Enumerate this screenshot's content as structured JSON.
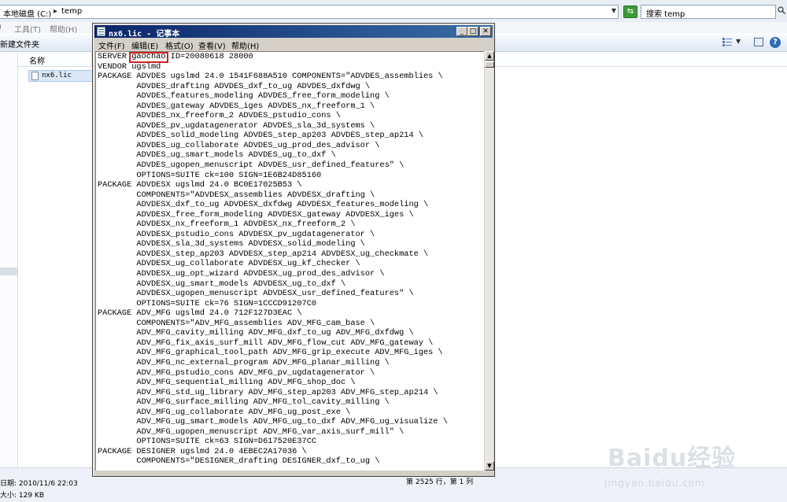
{
  "explorer": {
    "address_path": [
      "本地磁盘 (C:)",
      "temp"
    ],
    "search_placeholder": "搜索 temp",
    "menu": [
      "工具(T)",
      "帮助(H)"
    ],
    "toolbar": {
      "new_folder": "新建文件夹"
    },
    "column_header": "名称",
    "file": {
      "name": "nx6.lic"
    },
    "details": {
      "modified": "日期: 2010/11/6 22:03",
      "size": "大小: 129 KB"
    }
  },
  "notepad": {
    "title": "nx6.lic - 记事本",
    "menu": [
      "文件(F)",
      "编辑(E)",
      "格式(O)",
      "查看(V)",
      "帮助(H)"
    ],
    "highlighted_text": "gaochao",
    "lines": [
      "SERVER gaochao ID=20080618 28000",
      "VENDOR ugslmd",
      "PACKAGE ADVDES ugslmd 24.0 1541F688A510 COMPONENTS=\"ADVDES_assemblies \\",
      "        ADVDES_drafting ADVDES_dxf_to_ug ADVDES_dxfdwg \\",
      "        ADVDES_features_modeling ADVDES_free_form_modeling \\",
      "        ADVDES_gateway ADVDES_iges ADVDES_nx_freeform_1 \\",
      "        ADVDES_nx_freeform_2 ADVDES_pstudio_cons \\",
      "        ADVDES_pv_ugdatagenerator ADVDES_sla_3d_systems \\",
      "        ADVDES_solid_modeling ADVDES_step_ap203 ADVDES_step_ap214 \\",
      "        ADVDES_ug_collaborate ADVDES_ug_prod_des_advisor \\",
      "        ADVDES_ug_smart_models ADVDES_ug_to_dxf \\",
      "        ADVDES_ugopen_menuscript ADVDES_usr_defined_features\" \\",
      "        OPTIONS=SUITE ck=100 SIGN=1E6B24D85160",
      "PACKAGE ADVDESX ugslmd 24.0 BC0E17025B53 \\",
      "        COMPONENTS=\"ADVDESX_assemblies ADVDESX_drafting \\",
      "        ADVDESX_dxf_to_ug ADVDESX_dxfdwg ADVDESX_features_modeling \\",
      "        ADVDESX_free_form_modeling ADVDESX_gateway ADVDESX_iges \\",
      "        ADVDESX_nx_freeform_1 ADVDESX_nx_freeform_2 \\",
      "        ADVDESX_pstudio_cons ADVDESX_pv_ugdatagenerator \\",
      "        ADVDESX_sla_3d_systems ADVDESX_solid_modeling \\",
      "        ADVDESX_step_ap203 ADVDESX_step_ap214 ADVDESX_ug_checkmate \\",
      "        ADVDESX_ug_collaborate ADVDESX_ug_kf_checker \\",
      "        ADVDESX_ug_opt_wizard ADVDESX_ug_prod_des_advisor \\",
      "        ADVDESX_ug_smart_models ADVDESX_ug_to_dxf \\",
      "        ADVDESX_ugopen_menuscript ADVDESX_usr_defined_features\" \\",
      "        OPTIONS=SUITE ck=76 SIGN=1CCCD91207C0",
      "PACKAGE ADV_MFG ugslmd 24.0 712F127D3EAC \\",
      "        COMPONENTS=\"ADV_MFG_assemblies ADV_MFG_cam_base \\",
      "        ADV_MFG_cavity_milling ADV_MFG_dxf_to_ug ADV_MFG_dxfdwg \\",
      "        ADV_MFG_fix_axis_surf_mill ADV_MFG_flow_cut ADV_MFG_gateway \\",
      "        ADV_MFG_graphical_tool_path ADV_MFG_grip_execute ADV_MFG_iges \\",
      "        ADV_MFG_nc_external_program ADV_MFG_planar_milling \\",
      "        ADV_MFG_pstudio_cons ADV_MFG_pv_ugdatagenerator \\",
      "        ADV_MFG_sequential_milling ADV_MFG_shop_doc \\",
      "        ADV_MFG_std_ug_library ADV_MFG_step_ap203 ADV_MFG_step_ap214 \\",
      "        ADV_MFG_surface_milling ADV_MFG_tol_cavity_milling \\",
      "        ADV_MFG_ug_collaborate ADV_MFG_ug_post_exe \\",
      "        ADV_MFG_ug_smart_models ADV_MFG_ug_to_dxf ADV_MFG_ug_visualize \\",
      "        ADV_MFG_ugopen_menuscript ADV_MFG_var_axis_surf_mill\" \\",
      "        OPTIONS=SUITE ck=63 SIGN=D617520E37CC",
      "PACKAGE DESIGNER ugslmd 24.0 4EBEC2A17036 \\",
      "        COMPONENTS=\"DESIGNER_drafting DESIGNER_dxf_to_ug \\"
    ],
    "status": "第 2525 行，第 1 列"
  },
  "watermark": {
    "brand": "Baidu经验",
    "url": "jingyan.baidu.com"
  },
  "colors": {
    "title_bar_start": "#0a246a",
    "title_bar_end": "#3a6ea5",
    "highlight_border": "#d02020",
    "window_face": "#d4d0c8"
  }
}
